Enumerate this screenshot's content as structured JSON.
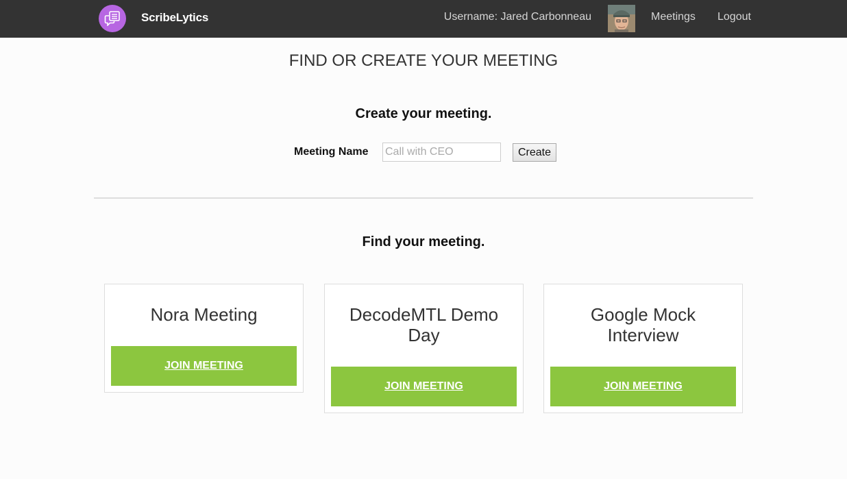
{
  "navbar": {
    "brand": "ScribeLytics",
    "username": "Username: Jared Carbonneau",
    "links": {
      "meetings": "Meetings",
      "logout": "Logout"
    }
  },
  "page": {
    "title": "FIND OR CREATE YOUR MEETING"
  },
  "create_section": {
    "heading": "Create your meeting.",
    "field_label": "Meeting Name",
    "input_value": "",
    "input_placeholder": "Call with CEO",
    "create_button": "Create"
  },
  "find_section": {
    "heading": "Find your meeting.",
    "meetings": [
      {
        "title": "Nora Meeting",
        "button": "JOIN MEETING"
      },
      {
        "title": "DecodeMTL Demo Day",
        "button": "JOIN MEETING"
      },
      {
        "title": "Google Mock Interview",
        "button": "JOIN MEETING"
      }
    ]
  },
  "icons": {
    "logo": "chat-bubbles-icon",
    "avatar": "user-avatar"
  },
  "colors": {
    "navbar_bg": "#333333",
    "logo_bg": "#b766e2",
    "join_button": "#8cc63f",
    "page_bg": "#fcfcfc"
  }
}
